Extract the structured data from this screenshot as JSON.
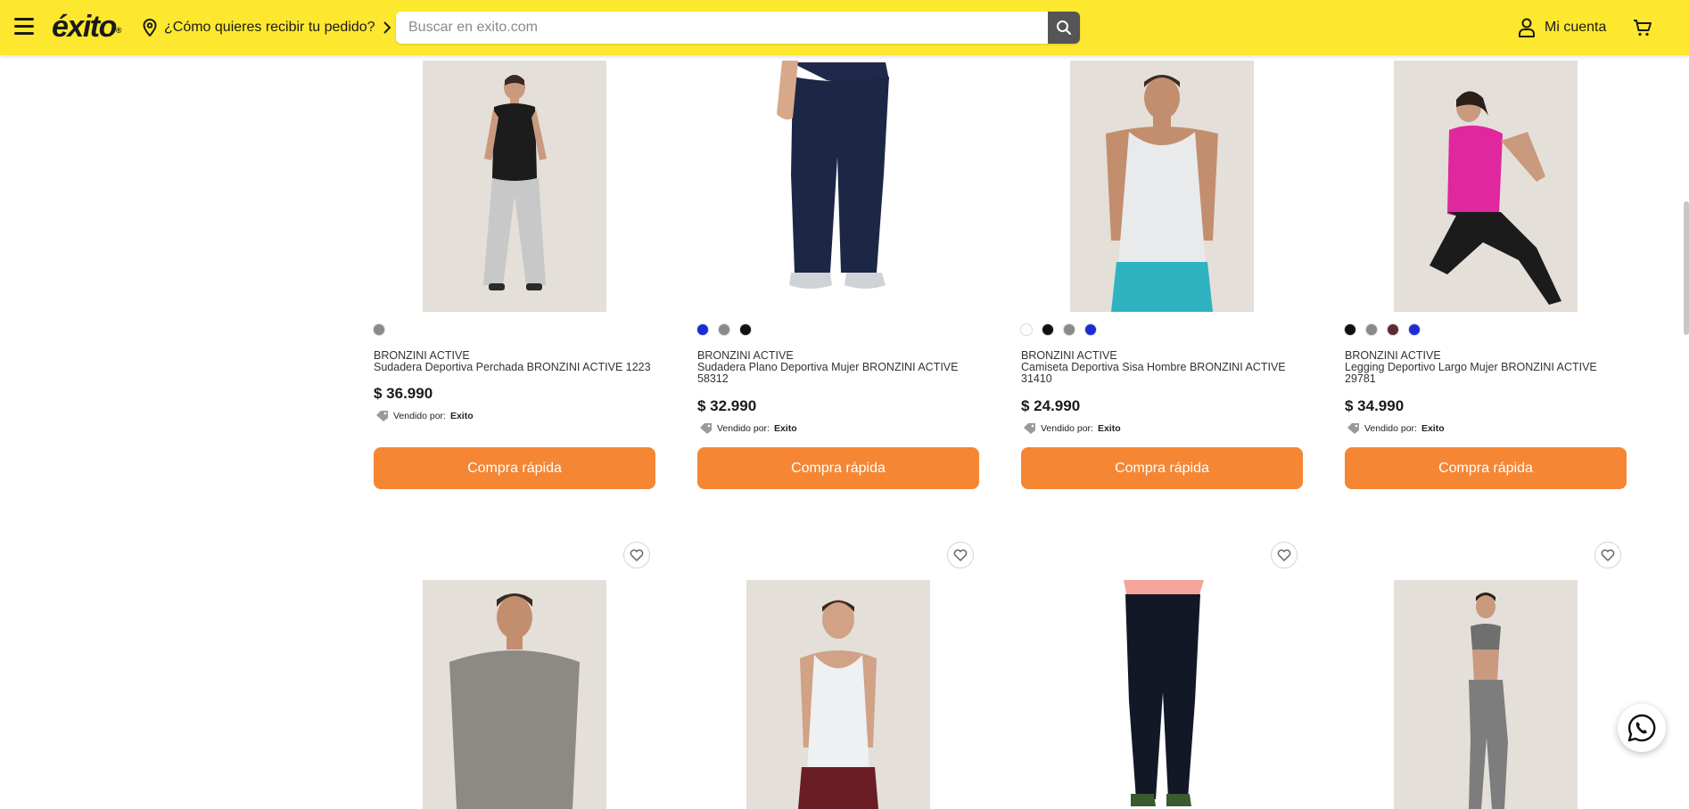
{
  "header": {
    "logo_text": "éxito",
    "logo_mark": "®",
    "delivery_text": "¿Cómo quieres recibir tu pedido?",
    "search_placeholder": "Buscar en exito.com",
    "account_label": "Mi cuenta",
    "icons": [
      "menu-icon",
      "location-pin-icon",
      "chevron-right-icon",
      "search-icon",
      "user-icon",
      "cart-icon"
    ]
  },
  "colors": {
    "header_bg": "#fde82f",
    "buy_button": "#f58634",
    "swatch_grey": "#8a8a8a",
    "swatch_blue": "#1b2bd6",
    "swatch_black": "#111111",
    "swatch_white": "#ffffff",
    "swatch_wine": "#5e2a33"
  },
  "products_row1": [
    {
      "brand": "BRONZINI ACTIVE",
      "title": "Sudadera Deportiva Perchada BRONZINI ACTIVE 1223",
      "price": "$ 36.990",
      "seller_label": "Vendido por:",
      "seller": "Exito",
      "button": "Compra rápida",
      "swatches": [
        "#8a8a8a"
      ]
    },
    {
      "brand": "BRONZINI ACTIVE",
      "title": "Sudadera Plano Deportiva Mujer BRONZINI ACTIVE 58312",
      "price": "$ 32.990",
      "seller_label": "Vendido por:",
      "seller": "Exito",
      "button": "Compra rápida",
      "swatches": [
        "#1b2bd6",
        "#8a8a8a",
        "#111111"
      ]
    },
    {
      "brand": "BRONZINI ACTIVE",
      "title": "Camiseta Deportiva Sisa Hombre BRONZINI ACTIVE 31410",
      "price": "$ 24.990",
      "seller_label": "Vendido por:",
      "seller": "Exito",
      "button": "Compra rápida",
      "swatches": [
        "#ffffff",
        "#111111",
        "#8a8a8a",
        "#1b2bd6"
      ]
    },
    {
      "brand": "BRONZINI ACTIVE",
      "title": "Legging Deportivo Largo Mujer BRONZINI ACTIVE 29781",
      "price": "$ 34.990",
      "seller_label": "Vendido por:",
      "seller": "Exito",
      "button": "Compra rápida",
      "swatches": [
        "#111111",
        "#8a8a8a",
        "#5e2a33",
        "#1b2bd6"
      ]
    }
  ],
  "products_row2_icons": [
    "heart-icon",
    "heart-icon",
    "heart-icon",
    "heart-icon"
  ],
  "floating": {
    "whatsapp_icon": "whatsapp-icon"
  }
}
